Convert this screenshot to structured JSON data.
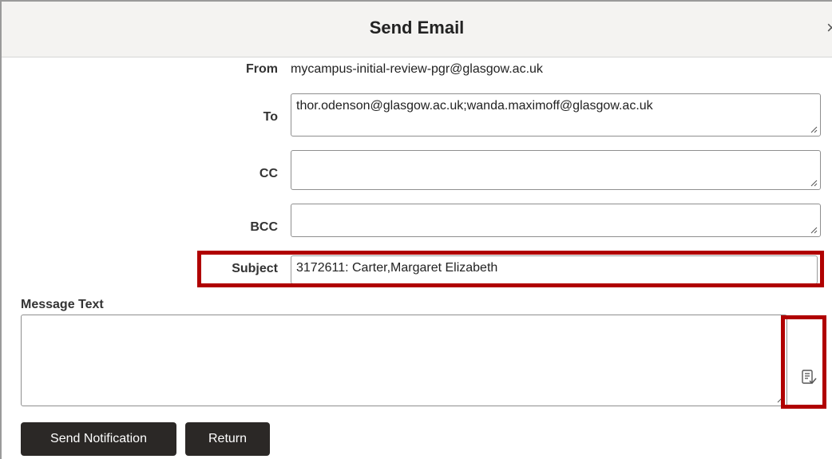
{
  "dialog": {
    "title": "Send Email",
    "close_glyph": "×"
  },
  "form": {
    "from_label": "From",
    "from_value": "mycampus-initial-review-pgr@glasgow.ac.uk",
    "to_label": "To",
    "to_value": "thor.odenson@glasgow.ac.uk;wanda.maximoff@glasgow.ac.uk",
    "cc_label": "CC",
    "cc_value": "",
    "bcc_label": "BCC",
    "bcc_value": "",
    "subject_label": "Subject",
    "subject_value": "3172611: Carter,Margaret Elizabeth",
    "message_label": "Message Text",
    "message_value": ""
  },
  "icons": {
    "spell_check": "spell-check-icon",
    "resize": "resize-grip-icon",
    "close": "close-icon"
  },
  "buttons": {
    "send_label": "Send Notification",
    "return_label": "Return"
  },
  "colors": {
    "highlight": "#b00000",
    "button_bg": "#2b2826",
    "header_bg": "#f4f3f1"
  }
}
